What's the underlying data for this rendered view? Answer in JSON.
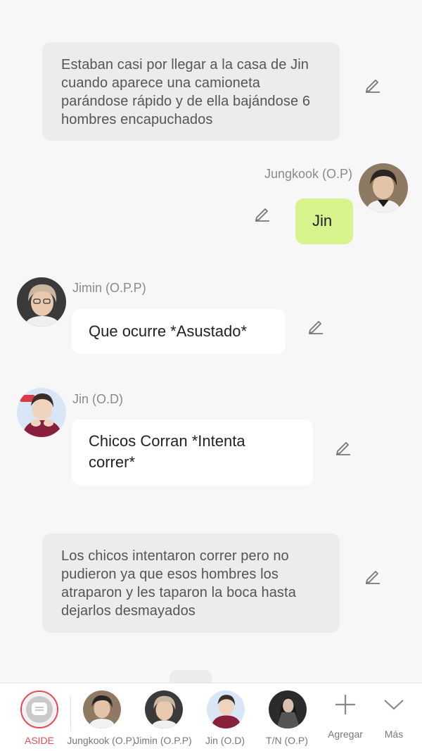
{
  "messages": {
    "narration1": "Estaban casi por llegar a la casa de Jin cuando aparece una camioneta parándose rápido y de ella bajándose 6 hombres encapuchados",
    "jungkook": {
      "name": "Jungkook (O.P)",
      "text": "Jin"
    },
    "jimin": {
      "name": "Jimin (O.P.P)",
      "text": "Que ocurre *Asustado*"
    },
    "jin": {
      "name": "Jin (O.D)",
      "text": "Chicos Corran *Intenta correr*"
    },
    "narration2": "Los chicos intentaron correr pero no pudieron ya que esos hombres los atraparon y les taparon la boca hasta dejarlos desmayados"
  },
  "bottom_bar": {
    "aside_label": "ASIDE",
    "characters": [
      {
        "label": "Jungkook (O.P)"
      },
      {
        "label": "Jimin (O.P.P)"
      },
      {
        "label": "Jin (O.D)"
      },
      {
        "label": "T/N (O.P)"
      }
    ],
    "add_label": "Agregar",
    "more_label": "Más"
  },
  "colors": {
    "accent": "#e64b5a",
    "user_bubble": "#d6f38d",
    "narration_bg": "#ececec"
  }
}
